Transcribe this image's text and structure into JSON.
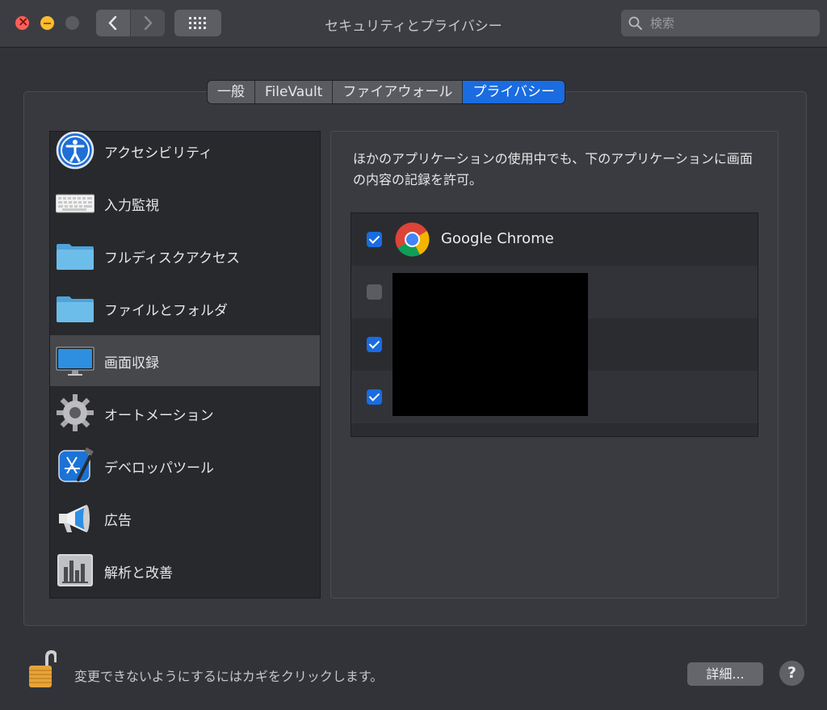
{
  "window": {
    "title": "セキュリティとプライバシー"
  },
  "search": {
    "placeholder": "検索"
  },
  "tabs": [
    {
      "label": "一般"
    },
    {
      "label": "FileVault"
    },
    {
      "label": "ファイアウォール"
    },
    {
      "label": "プライバシー",
      "selected": true
    }
  ],
  "sidebar": {
    "items": [
      {
        "label": "アクセシビリティ",
        "icon": "accessibility-icon"
      },
      {
        "label": "入力監視",
        "icon": "keyboard-icon"
      },
      {
        "label": "フルディスクアクセス",
        "icon": "folder-icon"
      },
      {
        "label": "ファイルとフォルダ",
        "icon": "folder-icon"
      },
      {
        "label": "画面収録",
        "icon": "display-icon",
        "selected": true
      },
      {
        "label": "オートメーション",
        "icon": "gear-icon"
      },
      {
        "label": "デベロッパツール",
        "icon": "xcode-icon"
      },
      {
        "label": "広告",
        "icon": "megaphone-icon"
      },
      {
        "label": "解析と改善",
        "icon": "chart-icon"
      }
    ]
  },
  "content": {
    "description": "ほかのアプリケーションの使用中でも、下のアプリケーションに画面の内容の記録を許可。",
    "apps": [
      {
        "name": "Google Chrome",
        "checked": true,
        "icon": "chrome-icon"
      },
      {
        "name": "",
        "checked": false,
        "redacted": true
      },
      {
        "name": "",
        "checked": true,
        "redacted": true
      },
      {
        "name": "",
        "checked": true,
        "redacted": true
      }
    ]
  },
  "footer": {
    "lock_text": "変更できないようにするにはカギをクリックします。",
    "details_label": "詳細...",
    "help_label": "?"
  },
  "colors": {
    "accent": "#1a6ce0",
    "background": "#323338",
    "sidebar_bg": "#28292d",
    "selected_row": "#46474b"
  }
}
